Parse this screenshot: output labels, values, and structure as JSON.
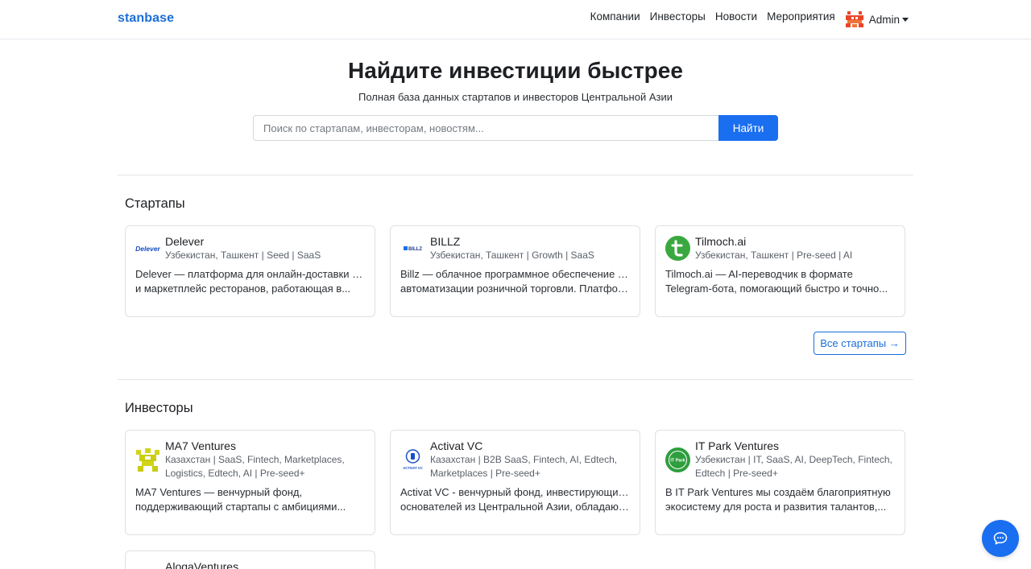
{
  "brand": "stanbase",
  "nav": {
    "links": [
      "Компании",
      "Инвесторы",
      "Новости",
      "Мероприятия"
    ],
    "user": "Admin"
  },
  "hero": {
    "title": "Найдите инвестиции быстрее",
    "subtitle": "Полная база данных стартапов и инвесторов Центральной Азии",
    "search_placeholder": "Поиск по стартапам, инвесторам, новостям...",
    "search_button": "Найти"
  },
  "startups": {
    "title": "Стартапы",
    "all_button": "Все стартапы →",
    "items": [
      {
        "name": "Delever",
        "logo_text": "Delever",
        "meta": "Узбекистан, Ташкент | Seed | SaaS",
        "desc": [
          "Delever — платформа для онлайн-доставки еды",
          "и маркетплейс ресторанов, работающая в..."
        ]
      },
      {
        "name": "BILLZ",
        "logo_text": "BILLZ",
        "meta": "Узбекистан, Ташкент | Growth | SaaS",
        "desc": [
          "Billz — облачное программное обеспечение для",
          "автоматизации розничной торговли. Платформ..."
        ]
      },
      {
        "name": "Tilmoch.ai",
        "meta": "Узбекистан, Ташкент | Pre-seed | AI",
        "desc": [
          "Tilmoch.ai — AI-переводчик в формате",
          "Telegram-бота, помогающий быстро и точно..."
        ]
      }
    ]
  },
  "investors": {
    "title": "Инвесторы",
    "items": [
      {
        "name": "MA7 Ventures",
        "meta": "Казахстан | SaaS, Fintech, Marketplaces, Logistics, Edtech, AI | Pre-seed+",
        "desc": [
          "MA7 Ventures — венчурный фонд,",
          "поддерживающий стартапы с амбициями..."
        ]
      },
      {
        "name": "Activat VC",
        "logo_text": "ACTIVAT VC",
        "meta": "Казахстан | B2B SaaS, Fintech, AI, Edtech, Marketplaces | Pre-seed+",
        "desc": [
          "Activat VC - венчурный фонд, инвестирующий в",
          "основателей из Центральной Азии, обладающи..."
        ]
      },
      {
        "name": "IT Park Ventures",
        "logo_text": "IT Park",
        "meta": "Узбекистан | IT, SaaS, AI, DeepTech, Fintech, Edtech | Pre-seed+",
        "desc": [
          "В IT Park Ventures мы создаём благоприятную",
          "экосистему для роста и развития талантов,..."
        ]
      },
      {
        "name": "AloqaVentures"
      }
    ]
  },
  "colors": {
    "primary": "#1a6ef0",
    "brand": "#1a6ed8",
    "border": "#dde1e6",
    "tilmoch_green": "#3aa83f",
    "ma7_yellow": "#d2d418",
    "itpark_green": "#2e9e3e"
  },
  "icons": {
    "chat": "chat-bubble-icon",
    "avatar": "avatar-icon"
  }
}
